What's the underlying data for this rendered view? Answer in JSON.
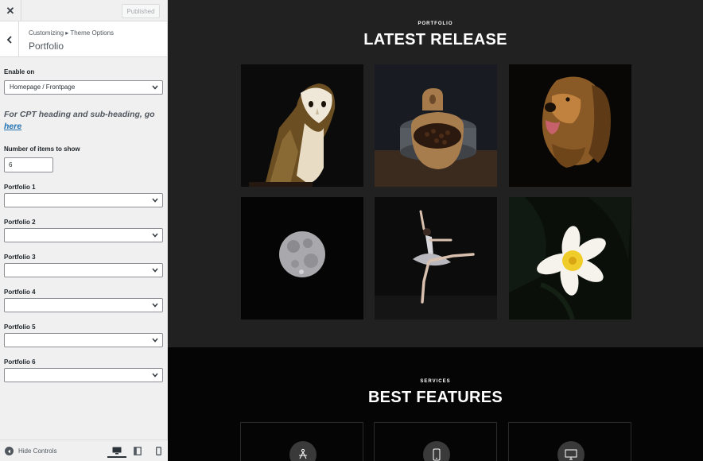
{
  "topbar": {
    "published_label": "Published"
  },
  "section": {
    "breadcrumb": "Customizing ▸ Theme Options",
    "title": "Portfolio"
  },
  "controls": {
    "enable_on": {
      "label": "Enable on",
      "value": "Homepage / Frontpage"
    },
    "cpt_note": {
      "text": "For CPT heading and sub-heading, go",
      "link": "here"
    },
    "items_to_show": {
      "label": "Number of items to show",
      "value": "6"
    },
    "portfolio_selects": [
      {
        "label": "Portfolio 1",
        "value": ""
      },
      {
        "label": "Portfolio 2",
        "value": ""
      },
      {
        "label": "Portfolio 3",
        "value": ""
      },
      {
        "label": "Portfolio 4",
        "value": ""
      },
      {
        "label": "Portfolio 5",
        "value": ""
      },
      {
        "label": "Portfolio 6",
        "value": ""
      }
    ]
  },
  "footer": {
    "hide_controls": "Hide Controls",
    "devices": [
      "desktop-icon",
      "tablet-icon",
      "mobile-icon"
    ],
    "active_device": "desktop"
  },
  "preview": {
    "portfolio": {
      "eyebrow": "PORTFOLIO",
      "title": "LATEST RELEASE",
      "tiles": [
        "owl",
        "coffee-beans",
        "dog",
        "moon",
        "ballerina",
        "flower"
      ]
    },
    "services": {
      "eyebrow": "SERVICES",
      "title": "BEST FEATURES",
      "cards": [
        "design-icon",
        "mobile-icon",
        "monitor-icon"
      ]
    }
  },
  "colors": {
    "link": "#2271b1",
    "preview_bg": "#212121",
    "services_bg": "#050505"
  }
}
